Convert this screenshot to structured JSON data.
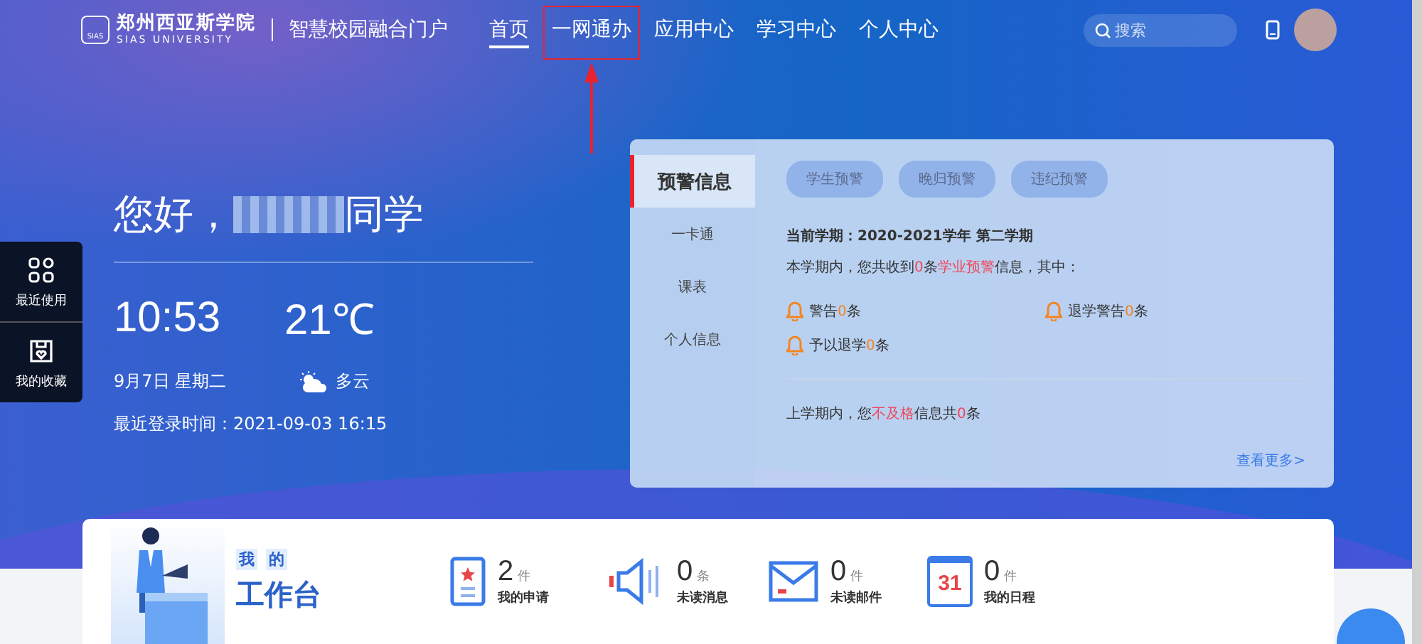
{
  "header": {
    "logo_cn": "郑州西亚斯学院",
    "logo_en": "SIAS UNIVERSITY",
    "logo_badge": "SIAS",
    "portal_title": "智慧校园融合门户",
    "nav": [
      {
        "label": "首页",
        "selected": true,
        "annotated": false
      },
      {
        "label": "一网通办",
        "selected": false,
        "annotated": true
      },
      {
        "label": "应用中心",
        "selected": false,
        "annotated": false
      },
      {
        "label": "学习中心",
        "selected": false,
        "annotated": false
      },
      {
        "label": "个人中心",
        "selected": false,
        "annotated": false
      }
    ],
    "search": {
      "placeholder": "搜索"
    }
  },
  "side_dock": [
    {
      "label": "最近使用",
      "kind": "grid"
    },
    {
      "label": "我的收藏",
      "kind": "bookmark"
    }
  ],
  "hero": {
    "greeting_prefix": "您好，",
    "greeting_suffix": "同学",
    "time": "10:53",
    "temperature": "21℃",
    "date": "9月7日 星期二",
    "weather": "多云",
    "last_login": "最近登录时间：2021-09-03 16:15"
  },
  "warning": {
    "tabs": [
      {
        "label": "预警信息",
        "selected": true
      },
      {
        "label": "一卡通",
        "selected": false
      },
      {
        "label": "课表",
        "selected": false
      },
      {
        "label": "个人信息",
        "selected": false
      }
    ],
    "filters": [
      "学生预警",
      "晚归预警",
      "违纪预警"
    ],
    "term": "当前学期：2020-2021学年 第二学期",
    "summary": [
      {
        "t": "本学期内，您共收到"
      },
      {
        "t": "0",
        "color": "#f0465a"
      },
      {
        "t": "条"
      },
      {
        "t": "学业预警",
        "color": "#f0465a"
      },
      {
        "t": "信息，其中："
      }
    ],
    "items": [
      [
        {
          "t": "警告"
        },
        {
          "t": "0",
          "color": "#f5841f"
        },
        {
          "t": "条"
        }
      ],
      [
        {
          "t": "退学警告"
        },
        {
          "t": "0",
          "color": "#f5841f"
        },
        {
          "t": "条"
        }
      ],
      [
        {
          "t": "予以退学"
        },
        {
          "t": "0",
          "color": "#f5841f"
        },
        {
          "t": "条"
        }
      ]
    ],
    "last_term": [
      {
        "t": "上学期内，您"
      },
      {
        "t": "不及格",
        "color": "#f0465a"
      },
      {
        "t": "信息共"
      },
      {
        "t": "0",
        "color": "#f0465a"
      },
      {
        "t": "条"
      }
    ],
    "more": "查看更多>"
  },
  "workbench": {
    "title_chars": [
      "我",
      "的"
    ],
    "title": "工作台",
    "stats": [
      {
        "count": "2",
        "unit": "件",
        "label": "我的申请",
        "kind": "application"
      },
      {
        "count": "0",
        "unit": "条",
        "label": "未读消息",
        "kind": "message"
      },
      {
        "count": "0",
        "unit": "件",
        "label": "未读邮件",
        "kind": "mail"
      },
      {
        "count": "0",
        "unit": "件",
        "label": "我的日程",
        "kind": "calendar",
        "icon_text": "31"
      }
    ]
  }
}
